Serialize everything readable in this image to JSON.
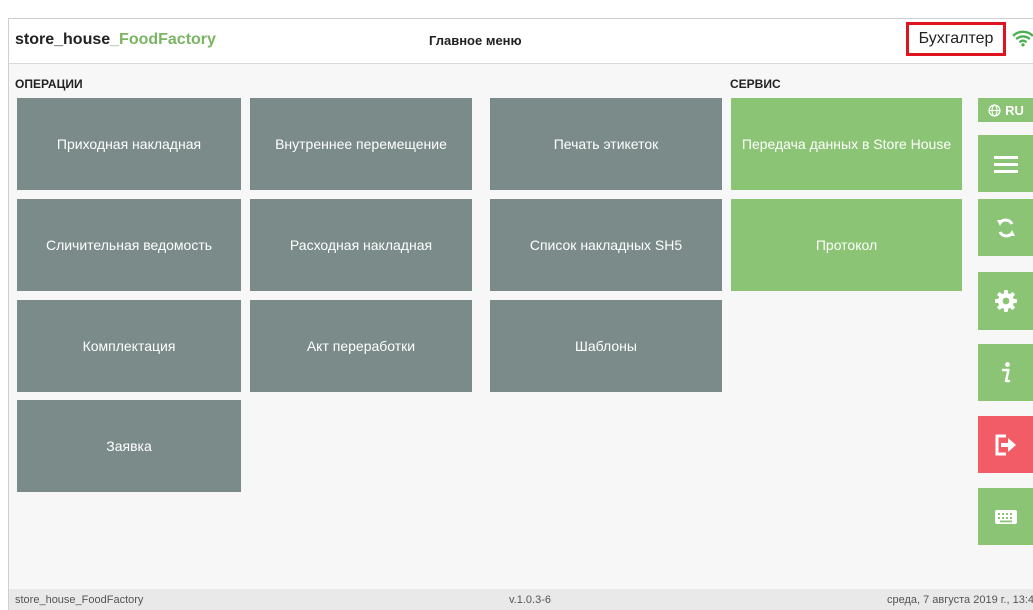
{
  "header": {
    "brand_prefix": "store_house",
    "brand_accent": "_FoodFactory",
    "title": "Главное меню",
    "user": "Бухгалтер"
  },
  "operations": {
    "heading": "ОПЕРАЦИИ",
    "tiles": [
      "Приходная накладная",
      "Внутреннее перемещение",
      "Печать этикеток",
      "Сличительная ведомость",
      "Расходная накладная",
      "Список накладных SH5",
      "Комплектация",
      "Акт переработки",
      "Шаблоны",
      "Заявка"
    ]
  },
  "service": {
    "heading": "СЕРВИС",
    "tiles": [
      "Передача данных в Store House",
      "Протокол"
    ]
  },
  "sidebar": {
    "language": "RU",
    "icons": [
      "globe-icon",
      "menu-icon",
      "sync-icon",
      "gear-icon",
      "info-icon",
      "logout-icon",
      "keyboard-icon"
    ]
  },
  "footer": {
    "app_name": "store_house_FoodFactory",
    "version": "v.1.0.3-6",
    "datetime": "среда, 7 августа 2019 г., 13:4"
  },
  "colors": {
    "tile_gray": "#7a8b89",
    "tile_green": "#8bc474",
    "brand_green": "#7ab564",
    "logout_red": "#f25c66",
    "highlight_red": "#e0141e"
  }
}
